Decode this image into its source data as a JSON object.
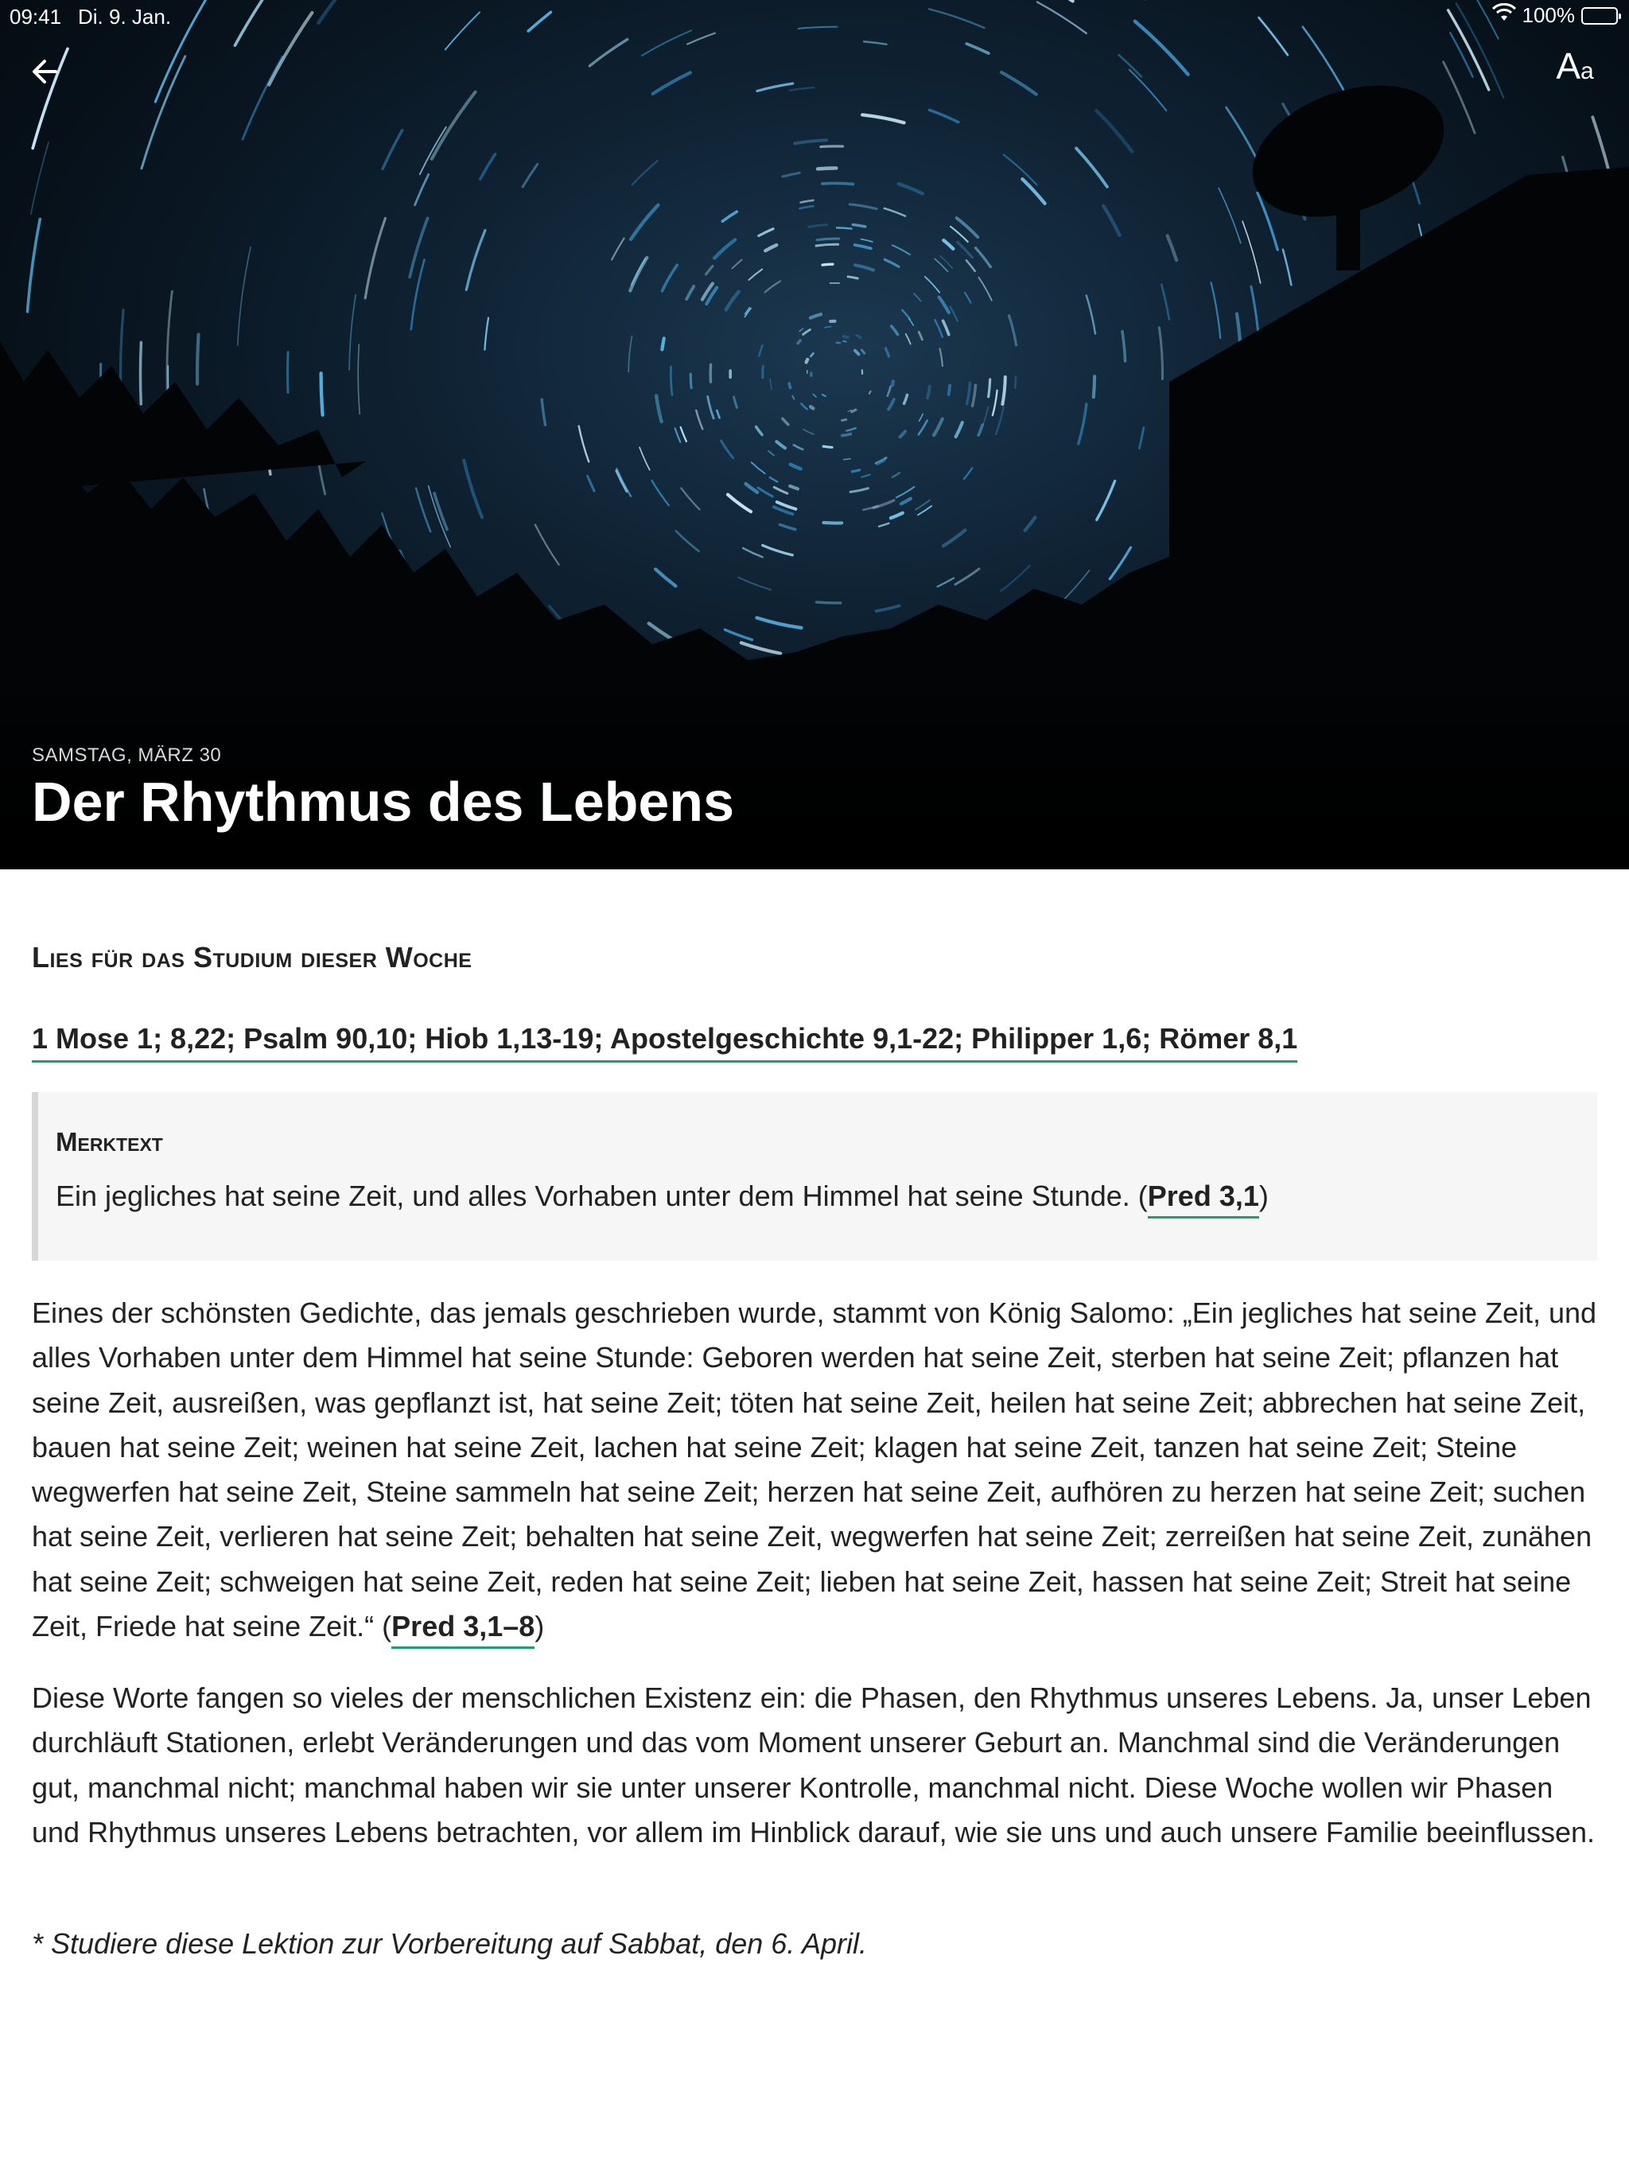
{
  "status_bar": {
    "time": "09:41",
    "date": "Di. 9. Jan.",
    "battery": "100%"
  },
  "toolbar": {
    "back_icon": "arrow-left-icon",
    "font_size_icon": "font-size-icon",
    "font_button_big": "A",
    "font_button_small": "a"
  },
  "hero": {
    "date": "SAMSTAG, MÄRZ 30",
    "title": "Der Rhythmus des Lebens"
  },
  "study": {
    "heading": "Lies für das Studium dieser Woche",
    "references": "1 Mose 1; 8,22; Psalm 90,10; Hiob 1,13-19; Apostelgeschichte 9,1-22; Philipper 1,6; Römer 8,1"
  },
  "memory_verse": {
    "title": "Merktext",
    "text": "Ein jegliches hat seine Zeit, und alles Vorhaben unter dem Himmel hat seine Stunde. (",
    "reference": "Pred 3,1",
    "close": ")"
  },
  "body": {
    "para1_text": "Eines der schönsten Gedichte, das jemals geschrieben wurde, stammt von König Salomo: „Ein jegliches hat seine Zeit, und alles Vorhaben unter dem Himmel hat seine Stunde: Geboren werden hat seine Zeit, sterben hat seine Zeit; pflanzen hat seine Zeit, ausreißen, was gepflanzt ist, hat seine Zeit; töten hat seine Zeit, heilen hat seine Zeit; abbrechen hat seine Zeit, bauen hat seine Zeit; weinen hat seine Zeit, lachen hat seine Zeit; klagen hat seine Zeit, tanzen hat seine Zeit; Steine wegwerfen hat seine Zeit, Steine sammeln hat seine Zeit; herzen hat seine Zeit, aufhören zu herzen hat seine Zeit; suchen hat seine Zeit, verlieren hat seine Zeit; behalten hat seine Zeit, wegwerfen hat seine Zeit; zerreißen hat seine Zeit, zunähen hat seine Zeit; schweigen hat seine Zeit, reden hat seine Zeit; lieben hat seine Zeit, hassen hat seine Zeit; Streit hat seine Zeit, Friede hat seine Zeit.“ (",
    "para1_ref": "Pred 3,1–8",
    "para1_close": ")",
    "para2": "Diese Worte fangen so vieles der menschlichen Existenz ein: die Phasen, den Rhythmus unseres Lebens. Ja, unser Leben durchläuft Stationen, erlebt Veränderungen und das vom Moment unserer Geburt an. Manchmal sind die Veränderungen gut, manchmal nicht; manchmal haben wir sie unter unserer Kontrolle, manchmal nicht. Diese Woche wollen wir Phasen und Rhythmus unseres Lebens betrachten, vor allem im Hinblick darauf, wie sie uns und auch unsere Familie beeinflussen.",
    "footnote": "* Studiere diese Lektion zur Vorbereitung auf Sabbat, den 6. April."
  }
}
